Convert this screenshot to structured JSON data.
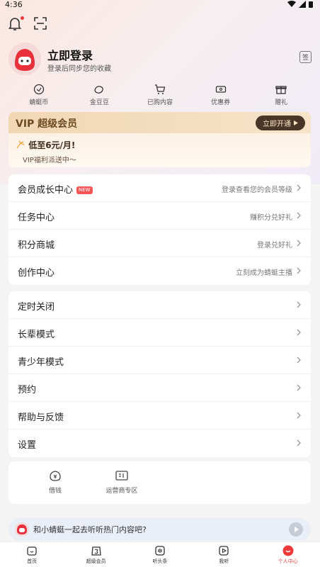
{
  "status": {
    "time": "4:36"
  },
  "profile": {
    "title": "立即登录",
    "subtitle": "登录后同步您的收藏",
    "checkin_label": "签"
  },
  "quick": [
    {
      "label": "蜻蜓币",
      "icon": "coin-icon"
    },
    {
      "label": "金豆豆",
      "icon": "bean-icon"
    },
    {
      "label": "已购内容",
      "icon": "cart-icon"
    },
    {
      "label": "优惠券",
      "icon": "coupon-icon"
    },
    {
      "label": "赠礼",
      "icon": "gift-icon"
    }
  ],
  "vip": {
    "title": "VIP 超级会员",
    "button": "立即开通",
    "price": "低至6元/月!",
    "desc": "VIP福利派送中～"
  },
  "menu1": [
    {
      "label": "会员成长中心",
      "right": "登录查看您的会员等级",
      "badge": "NEW"
    },
    {
      "label": "任务中心",
      "right": "赚积分兑好礼"
    },
    {
      "label": "积分商城",
      "right": "登录兑好礼"
    },
    {
      "label": "创作中心",
      "right": "立刻成为蜻蜓主播"
    }
  ],
  "menu2": [
    {
      "label": "定时关闭"
    },
    {
      "label": "长辈模式"
    },
    {
      "label": "青少年模式"
    },
    {
      "label": "预约"
    },
    {
      "label": "帮助与反馈"
    },
    {
      "label": "设置"
    }
  ],
  "tools": [
    {
      "label": "借钱",
      "icon": "loan-icon"
    },
    {
      "label": "运营商专区",
      "icon": "operator-icon"
    }
  ],
  "prompt": {
    "text": "和小蜻蜓一起去听听热门内容吧?"
  },
  "tabs": [
    {
      "label": "首页",
      "icon": "home-icon"
    },
    {
      "label": "超级会员",
      "icon": "vip-icon"
    },
    {
      "label": "听头条",
      "icon": "headline-icon"
    },
    {
      "label": "我听",
      "icon": "play-icon"
    },
    {
      "label": "个人中心",
      "icon": "profile-icon",
      "active": true
    }
  ],
  "colors": {
    "accent": "#f03a3a",
    "vip_dark": "#4a3526",
    "vip_gold": "#f1d7b4"
  }
}
